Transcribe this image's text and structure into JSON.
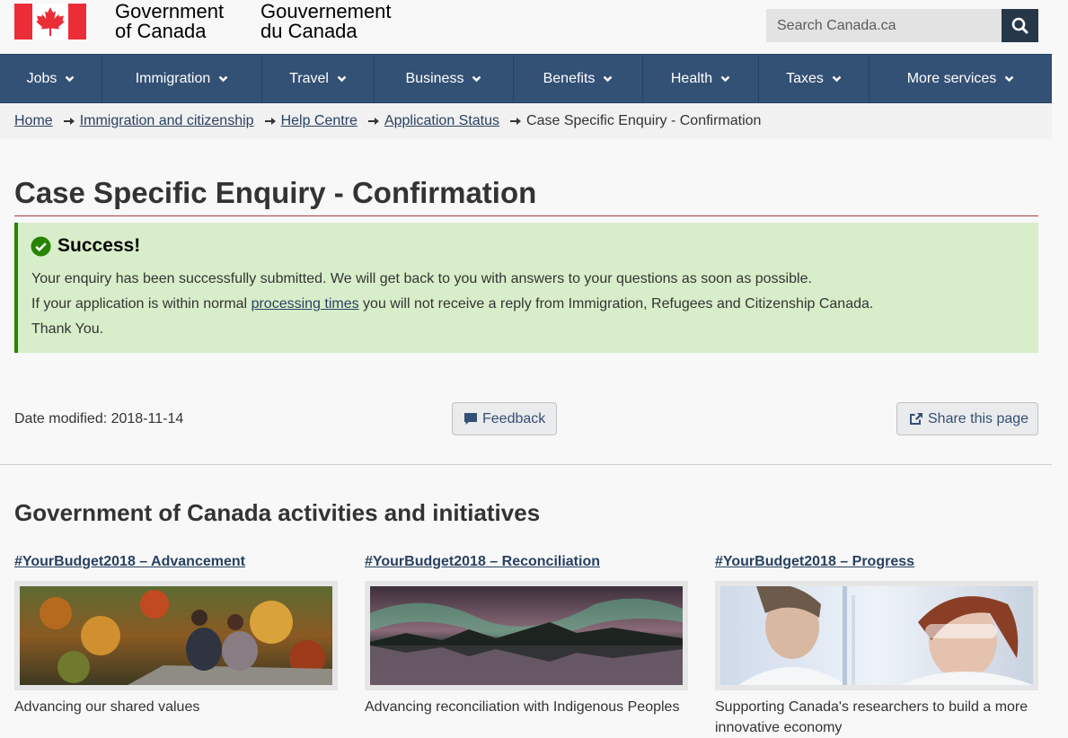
{
  "header": {
    "wordmark_en": [
      "Government",
      "of Canada"
    ],
    "wordmark_fr": [
      "Gouvernement",
      "du Canada"
    ],
    "search_placeholder": "Search Canada.ca"
  },
  "nav": {
    "items": [
      {
        "label": "Jobs"
      },
      {
        "label": "Immigration"
      },
      {
        "label": "Travel"
      },
      {
        "label": "Business"
      },
      {
        "label": "Benefits"
      },
      {
        "label": "Health"
      },
      {
        "label": "Taxes"
      },
      {
        "label": "More services"
      }
    ]
  },
  "breadcrumb": {
    "links": [
      "Home",
      "Immigration and citizenship",
      "Help Centre",
      "Application Status"
    ],
    "current": "Case Specific Enquiry - Confirmation"
  },
  "page_title": "Case Specific Enquiry - Confirmation",
  "alert": {
    "title": "Success!",
    "line1": "Your enquiry has been successfully submitted. We will get back to you with answers to your questions as soon as possible.",
    "line2_before": "If your application is within normal ",
    "line2_link": "processing times",
    "line2_after": " you will not receive a reply from Immigration, Refugees and Citizenship Canada.",
    "line3": "Thank You."
  },
  "footer_meta": {
    "date_modified": "Date modified: 2018-11-14",
    "feedback_label": "Feedback",
    "share_label": "Share this page"
  },
  "activities": {
    "heading": "Government of Canada activities and initiatives",
    "cards": [
      {
        "title": "#YourBudget2018 – Advancement",
        "description": "Advancing our shared values"
      },
      {
        "title": "#YourBudget2018 – Reconciliation",
        "description": "Advancing reconciliation with Indigenous Peoples"
      },
      {
        "title": "#YourBudget2018 – Progress",
        "description": "Supporting Canada's researchers to build a more innovative economy"
      }
    ]
  },
  "colors": {
    "flag_red": "#eb2d37",
    "nav_bg": "#335075",
    "search_button": "#26374a",
    "alert_bg": "#d8eeca",
    "alert_border": "#278400",
    "link": "#284162",
    "title_rule": "#af3c43"
  }
}
